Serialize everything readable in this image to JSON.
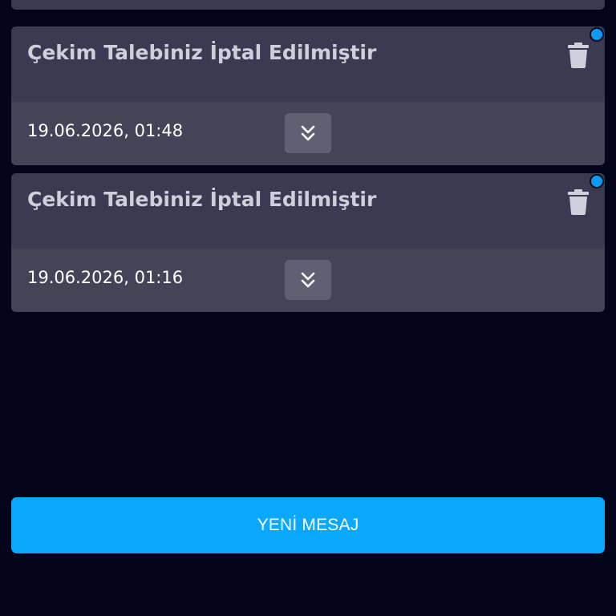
{
  "messages": [
    {
      "title": "Çekim Talebiniz İptal Edilmiştir",
      "date": "19.06.2026, 01:48",
      "unread": true
    },
    {
      "title": "Çekim Talebiniz İptal Edilmiştir",
      "date": "19.06.2026, 01:16",
      "unread": true
    }
  ],
  "new_message_label": "YENİ MESAJ",
  "icons": {
    "delete": "trash-icon",
    "expand": "chevron-double-down-icon",
    "unread": "unread-dot"
  },
  "colors": {
    "background": "#04051c",
    "card_header": "#3a3a52",
    "card_footer": "#444459",
    "unread_dot": "#0b9bf5",
    "primary_button": "#0aa8fc"
  }
}
